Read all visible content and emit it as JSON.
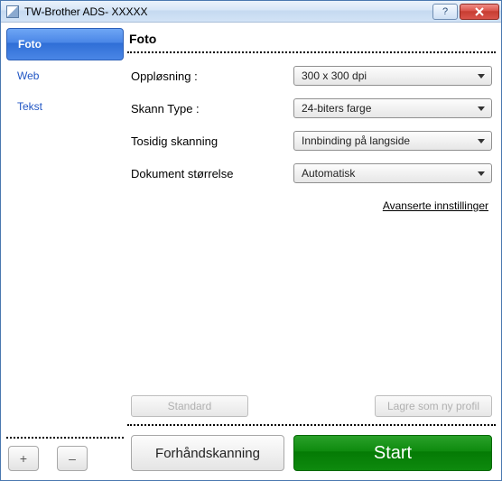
{
  "window": {
    "title": "TW-Brother ADS- XXXXX"
  },
  "sidebar": {
    "tabs": [
      {
        "label": "Foto",
        "active": true
      },
      {
        "label": "Web",
        "active": false
      },
      {
        "label": "Tekst",
        "active": false
      }
    ],
    "add_label": "+",
    "remove_label": "–"
  },
  "panel": {
    "title": "Foto",
    "rows": {
      "resolution": {
        "label": "Oppløsning :",
        "value": "300 x 300 dpi"
      },
      "scan_type": {
        "label": "Skann Type :",
        "value": "24-biters farge"
      },
      "duplex": {
        "label": "Tosidig skanning",
        "value": "Innbinding på langside"
      },
      "doc_size": {
        "label": "Dokument størrelse",
        "value": "Automatisk"
      }
    },
    "advanced_link": "Avanserte innstillinger",
    "buttons": {
      "standard": "Standard",
      "save_profile": "Lagre som ny profil",
      "preview": "Forhåndskanning",
      "start": "Start"
    }
  }
}
